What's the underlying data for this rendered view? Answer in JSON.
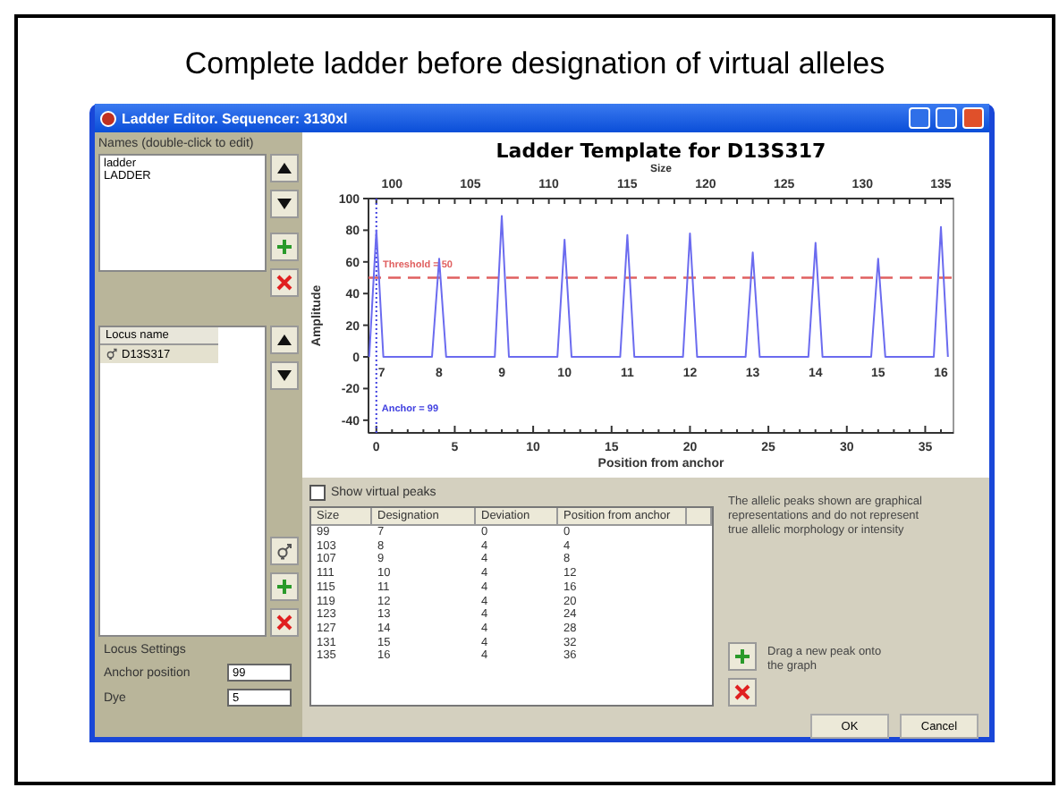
{
  "slide": {
    "title": "Complete ladder before designation of virtual alleles"
  },
  "window": {
    "title": "Ladder Editor. Sequencer: 3130xl"
  },
  "names": {
    "label": "Names (double-click to edit)",
    "items": [
      "ladder",
      "LADDER"
    ]
  },
  "loci": {
    "column": "Locus name",
    "items": [
      {
        "label": "D13S317",
        "selected": true
      }
    ]
  },
  "locus_settings": {
    "heading": "Locus Settings",
    "fields": [
      {
        "label": "Anchor position",
        "value": "99"
      },
      {
        "label": "Dye",
        "value": "5"
      }
    ]
  },
  "chart": {
    "anchor_label": "Anchor = 99",
    "size_axis": {
      "label": "Size",
      "ticks": [
        "100",
        "105",
        "110",
        "115",
        "120",
        "125",
        "130",
        "135"
      ]
    },
    "chart_data": {
      "type": "line",
      "title": "Ladder Template for D13S317",
      "xlabel": "Position from anchor",
      "ylabel": "Amplitude",
      "x": [
        -0.45,
        0,
        0.45,
        3.55,
        4,
        4.45,
        7.55,
        8,
        8.45,
        11.55,
        12,
        12.45,
        15.55,
        16,
        16.45,
        19.55,
        20,
        20.45,
        23.55,
        24,
        24.45,
        27.55,
        28,
        28.45,
        31.55,
        32,
        32.45,
        35.55,
        36,
        36.45
      ],
      "series": [
        {
          "color": "#6b6bef",
          "values": [
            0,
            80,
            0,
            0,
            62,
            0,
            0,
            89,
            0,
            0,
            74,
            0,
            0,
            77,
            0,
            0,
            78,
            0,
            0,
            66,
            0,
            0,
            72,
            0,
            0,
            62,
            0,
            0,
            82,
            0
          ]
        }
      ],
      "xlim": [
        -0.5,
        36.8
      ],
      "ylim": [
        -48,
        100
      ],
      "xticks": [
        0,
        5,
        10,
        15,
        20,
        25,
        30,
        35
      ],
      "yticks": [
        -40,
        -20,
        0,
        20,
        40,
        60,
        80,
        100
      ],
      "ref_lines": [
        {
          "axis": "y",
          "value": 50,
          "label": "Threshold = 50",
          "color": "#e06060"
        },
        {
          "axis": "x",
          "value": 0,
          "color": "#4040e0"
        }
      ],
      "annotations": [
        "7",
        "8",
        "9",
        "10",
        "11",
        "12",
        "13",
        "14",
        "15",
        "16"
      ]
    }
  },
  "virtual_peaks": {
    "label": "Show virtual peaks",
    "checked": false
  },
  "table": {
    "columns": [
      "Size",
      "Designation",
      "Deviation",
      "Position from anchor"
    ],
    "rows": [
      [
        "99",
        "7",
        "0",
        "0"
      ],
      [
        "103",
        "8",
        "4",
        "4"
      ],
      [
        "107",
        "9",
        "4",
        "8"
      ],
      [
        "111",
        "10",
        "4",
        "12"
      ],
      [
        "115",
        "11",
        "4",
        "16"
      ],
      [
        "119",
        "12",
        "4",
        "20"
      ],
      [
        "123",
        "13",
        "4",
        "24"
      ],
      [
        "127",
        "14",
        "4",
        "28"
      ],
      [
        "131",
        "15",
        "4",
        "32"
      ],
      [
        "135",
        "16",
        "4",
        "36"
      ]
    ]
  },
  "note": "The allelic peaks shown are graphical representations and do not represent true allelic morphology or intensity",
  "drag_hint": "Drag a new peak onto the graph",
  "buttons": [
    "OK",
    "Cancel"
  ]
}
